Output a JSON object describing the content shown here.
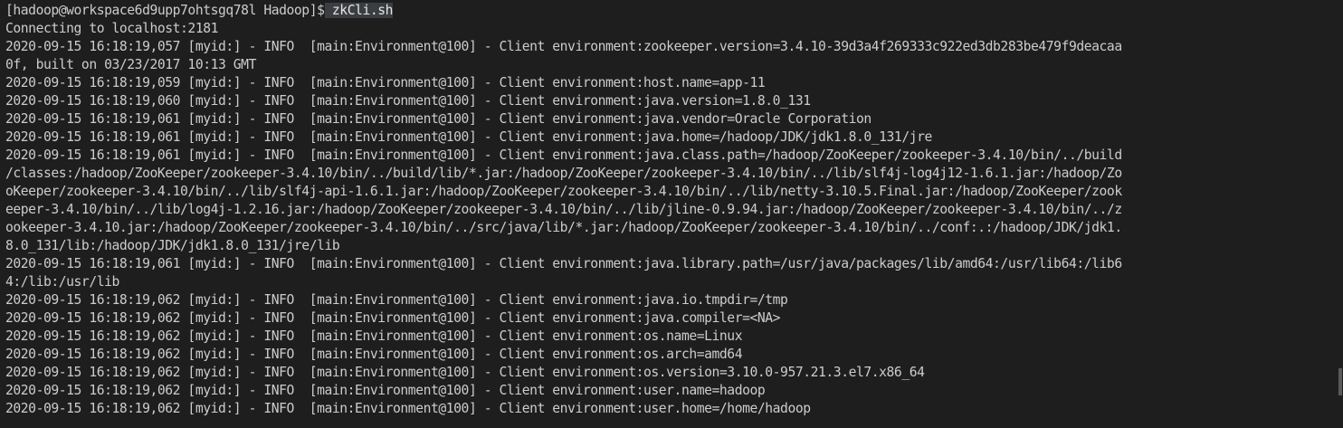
{
  "terminal": {
    "prompt": "[hadoop@workspace6d9upp7ohtsgq78l Hadoop]$",
    "command": "zkCli.sh",
    "lines": [
      "Connecting to localhost:2181",
      "2020-09-15 16:18:19,057 [myid:] - INFO  [main:Environment@100] - Client environment:zookeeper.version=3.4.10-39d3a4f269333c922ed3db283be479f9deacaa",
      "0f, built on 03/23/2017 10:13 GMT",
      "2020-09-15 16:18:19,059 [myid:] - INFO  [main:Environment@100] - Client environment:host.name=app-11",
      "2020-09-15 16:18:19,060 [myid:] - INFO  [main:Environment@100] - Client environment:java.version=1.8.0_131",
      "2020-09-15 16:18:19,061 [myid:] - INFO  [main:Environment@100] - Client environment:java.vendor=Oracle Corporation",
      "2020-09-15 16:18:19,061 [myid:] - INFO  [main:Environment@100] - Client environment:java.home=/hadoop/JDK/jdk1.8.0_131/jre",
      "2020-09-15 16:18:19,061 [myid:] - INFO  [main:Environment@100] - Client environment:java.class.path=/hadoop/ZooKeeper/zookeeper-3.4.10/bin/../build",
      "/classes:/hadoop/ZooKeeper/zookeeper-3.4.10/bin/../build/lib/*.jar:/hadoop/ZooKeeper/zookeeper-3.4.10/bin/../lib/slf4j-log4j12-1.6.1.jar:/hadoop/Zo",
      "oKeeper/zookeeper-3.4.10/bin/../lib/slf4j-api-1.6.1.jar:/hadoop/ZooKeeper/zookeeper-3.4.10/bin/../lib/netty-3.10.5.Final.jar:/hadoop/ZooKeeper/zook",
      "eeper-3.4.10/bin/../lib/log4j-1.2.16.jar:/hadoop/ZooKeeper/zookeeper-3.4.10/bin/../lib/jline-0.9.94.jar:/hadoop/ZooKeeper/zookeeper-3.4.10/bin/../z",
      "ookeeper-3.4.10.jar:/hadoop/ZooKeeper/zookeeper-3.4.10/bin/../src/java/lib/*.jar:/hadoop/ZooKeeper/zookeeper-3.4.10/bin/../conf:.:/hadoop/JDK/jdk1.",
      "8.0_131/lib:/hadoop/JDK/jdk1.8.0_131/jre/lib",
      "2020-09-15 16:18:19,061 [myid:] - INFO  [main:Environment@100] - Client environment:java.library.path=/usr/java/packages/lib/amd64:/usr/lib64:/lib6",
      "4:/lib:/usr/lib",
      "2020-09-15 16:18:19,062 [myid:] - INFO  [main:Environment@100] - Client environment:java.io.tmpdir=/tmp",
      "2020-09-15 16:18:19,062 [myid:] - INFO  [main:Environment@100] - Client environment:java.compiler=<NA>",
      "2020-09-15 16:18:19,062 [myid:] - INFO  [main:Environment@100] - Client environment:os.name=Linux",
      "2020-09-15 16:18:19,062 [myid:] - INFO  [main:Environment@100] - Client environment:os.arch=amd64",
      "2020-09-15 16:18:19,062 [myid:] - INFO  [main:Environment@100] - Client environment:os.version=3.10.0-957.21.3.el7.x86_64",
      "2020-09-15 16:18:19,062 [myid:] - INFO  [main:Environment@100] - Client environment:user.name=hadoop",
      "2020-09-15 16:18:19,062 [myid:] - INFO  [main:Environment@100] - Client environment:user.home=/home/hadoop"
    ]
  },
  "colors": {
    "background": "#1e1e1e",
    "text": "#cccccc",
    "command_highlight": "#3a3d41"
  }
}
